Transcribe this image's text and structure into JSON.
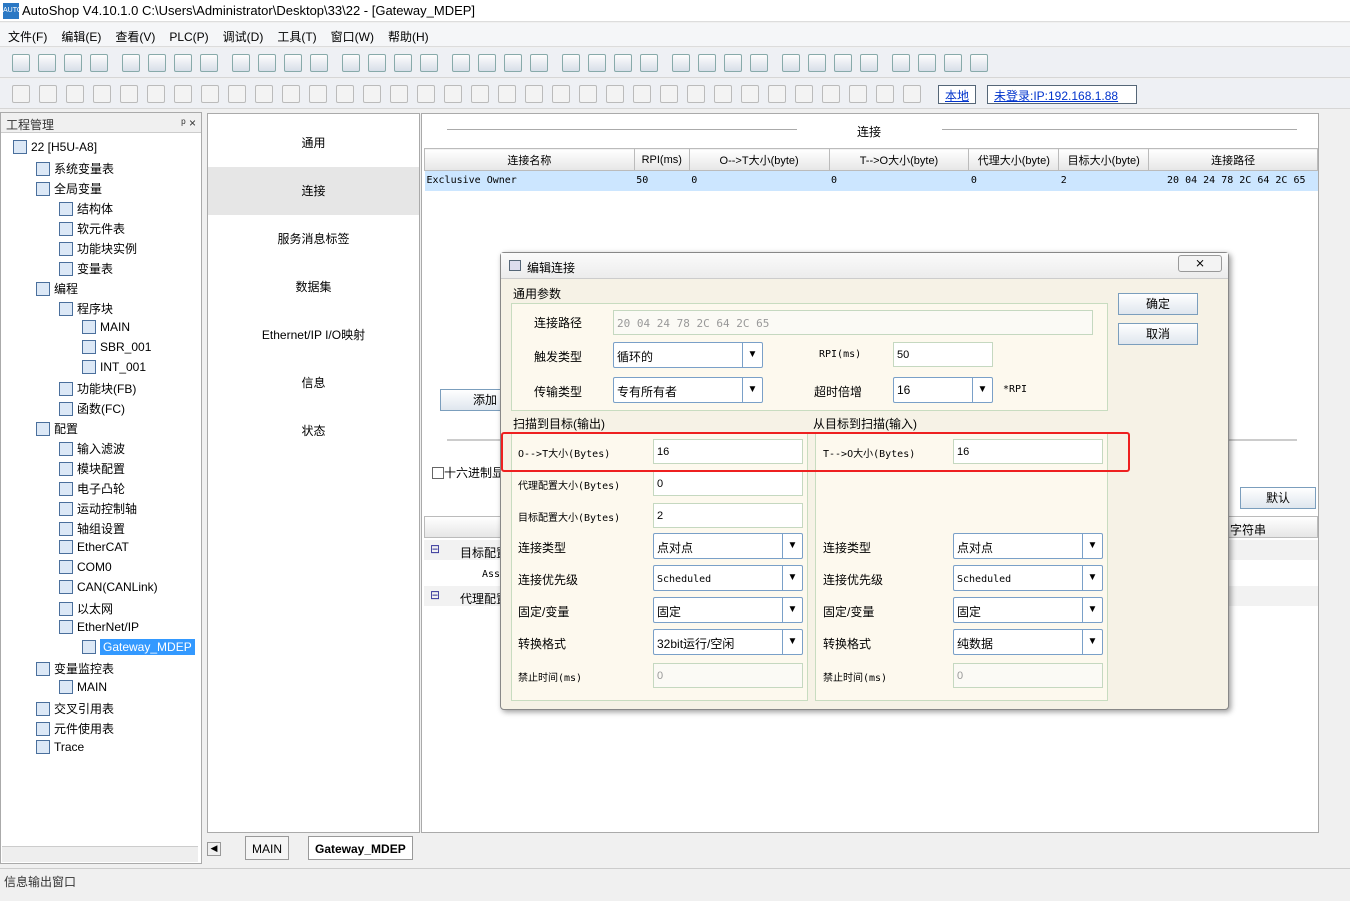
{
  "window": {
    "title": "AutoShop V4.10.1.0  C:\\Users\\Administrator\\Desktop\\33\\22 - [Gateway_MDEP]"
  },
  "menu": [
    "文件(F)",
    "编辑(E)",
    "查看(V)",
    "PLC(P)",
    "调试(D)",
    "工具(T)",
    "窗口(W)",
    "帮助(H)"
  ],
  "toolbar": {
    "local_label": "本地",
    "login_label": "未登录:IP:192.168.1.88"
  },
  "project": {
    "header": "工程管理",
    "pin": "ᵖ ×",
    "tree": [
      {
        "label": "22 [H5U-A8]",
        "level": 0
      },
      {
        "label": "系统变量表",
        "level": 1
      },
      {
        "label": "全局变量",
        "level": 1
      },
      {
        "label": "结构体",
        "level": 2
      },
      {
        "label": "软元件表",
        "level": 2
      },
      {
        "label": "功能块实例",
        "level": 2
      },
      {
        "label": "变量表",
        "level": 2
      },
      {
        "label": "编程",
        "level": 1
      },
      {
        "label": "程序块",
        "level": 2
      },
      {
        "label": "MAIN",
        "level": 3
      },
      {
        "label": "SBR_001",
        "level": 3
      },
      {
        "label": "INT_001",
        "level": 3
      },
      {
        "label": "功能块(FB)",
        "level": 2
      },
      {
        "label": "函数(FC)",
        "level": 2
      },
      {
        "label": "配置",
        "level": 1
      },
      {
        "label": "输入滤波",
        "level": 2
      },
      {
        "label": "模块配置",
        "level": 2
      },
      {
        "label": "电子凸轮",
        "level": 2
      },
      {
        "label": "运动控制轴",
        "level": 2
      },
      {
        "label": "轴组设置",
        "level": 2
      },
      {
        "label": "EtherCAT",
        "level": 2
      },
      {
        "label": "COM0",
        "level": 2
      },
      {
        "label": "CAN(CANLink)",
        "level": 2
      },
      {
        "label": "以太网",
        "level": 2
      },
      {
        "label": "EtherNet/IP",
        "level": 2
      },
      {
        "label": "Gateway_MDEP",
        "level": 3,
        "selected": true
      },
      {
        "label": "变量监控表",
        "level": 1
      },
      {
        "label": "MAIN",
        "level": 2
      },
      {
        "label": "交叉引用表",
        "level": 1
      },
      {
        "label": "元件使用表",
        "level": 1
      },
      {
        "label": "Trace",
        "level": 1
      }
    ]
  },
  "nav": [
    "通用",
    "连接",
    "服务消息标签",
    "数据集",
    "Ethernet/IP I/O映射",
    "信息",
    "状态"
  ],
  "nav_active": 1,
  "connection": {
    "section_title": "连接",
    "columns": [
      "连接名称",
      "RPI(ms)",
      "O-->T大小(byte)",
      "T-->O大小(byte)",
      "代理大小(byte)",
      "目标大小(byte)",
      "连接路径"
    ],
    "rows": [
      [
        "Exclusive Owner",
        "50",
        "0",
        "0",
        "0",
        "2",
        "20 04 24 78 2C 64 2C 65"
      ]
    ],
    "add_button": "添加",
    "hex_checkbox": "十六进制显示",
    "default_button": "默认",
    "string_col": "字符串",
    "tree_rows": [
      "目标配置",
      "Ass",
      "代理配置"
    ]
  },
  "dialog": {
    "title": "编辑连接",
    "close": "⨯",
    "general_label": "通用参数",
    "path_label": "连接路径",
    "path_value": "20 04 24 78 2C 64 2C 65",
    "trigger_label": "触发类型",
    "trigger_value": "循环的",
    "rpi_label": "RPI(ms)",
    "rpi_value": "50",
    "transport_label": "传输类型",
    "transport_value": "专有所有者",
    "timeout_label": "超时倍增",
    "timeout_value": "16",
    "timeout_unit": "*RPI",
    "ok": "确定",
    "cancel": "取消",
    "out_title": "扫描到目标(输出)",
    "in_title": "从目标到扫描(输入)",
    "out": {
      "size_label": "O-->T大小(Bytes)",
      "size_value": "16",
      "proxy_label": "代理配置大小(Bytes)",
      "proxy_value": "0",
      "target_label": "目标配置大小(Bytes)",
      "target_value": "2",
      "conn_type_label": "连接类型",
      "conn_type_value": "点对点",
      "priority_label": "连接优先级",
      "priority_value": "Scheduled",
      "fixed_label": "固定/变量",
      "fixed_value": "固定",
      "format_label": "转换格式",
      "format_value": "32bit运行/空闲",
      "inhibit_label": "禁止时间(ms)",
      "inhibit_value": "0"
    },
    "in": {
      "size_label": "T-->O大小(Bytes)",
      "size_value": "16",
      "conn_type_label": "连接类型",
      "conn_type_value": "点对点",
      "priority_label": "连接优先级",
      "priority_value": "Scheduled",
      "fixed_label": "固定/变量",
      "fixed_value": "固定",
      "format_label": "转换格式",
      "format_value": "纯数据",
      "inhibit_label": "禁止时间(ms)",
      "inhibit_value": "0"
    }
  },
  "tabs": [
    "MAIN",
    "Gateway_MDEP"
  ],
  "output_window": "信息输出窗口",
  "colors": {
    "selection": "#3399ff",
    "row_highlight": "#cce6ff",
    "dialog_bg": "#f6f2e6",
    "highlight_box": "#ee2020"
  }
}
